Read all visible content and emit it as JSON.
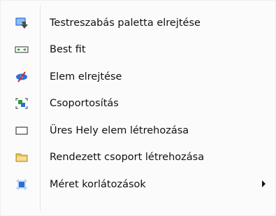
{
  "menu": {
    "items": [
      {
        "label": "Testreszabás paletta elrejtése",
        "icon": "hide-palette-icon"
      },
      {
        "label": "Best fit",
        "icon": "best-fit-icon"
      },
      {
        "label": "Elem elrejtése",
        "icon": "hide-item-icon"
      },
      {
        "label": "Csoportosítás",
        "icon": "group-icon"
      },
      {
        "label": "Üres Hely elem létrehozása",
        "icon": "empty-space-icon"
      },
      {
        "label": "Rendezett csoport létrehozása",
        "icon": "folder-icon"
      },
      {
        "label": "Méret korlátozások",
        "icon": "size-constraints-icon",
        "has_submenu": true
      }
    ]
  },
  "colors": {
    "blue": "#2b6fd6",
    "light_blue": "#8fbef0",
    "green": "#2e9b3a",
    "folder": "#e8c25b"
  }
}
